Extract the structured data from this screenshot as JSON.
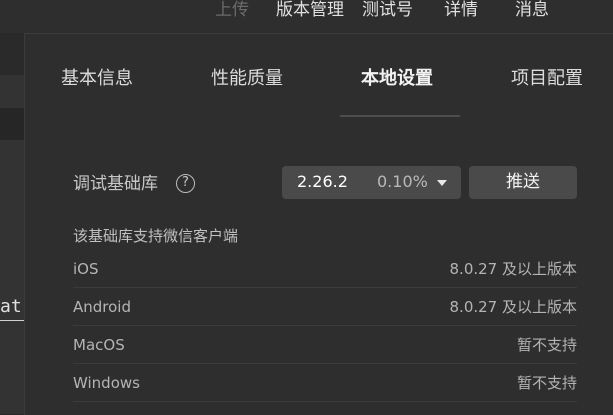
{
  "toolbar": {
    "upload": "上传",
    "version_manage": "版本管理",
    "test_account": "测试号",
    "details": "详情",
    "messages": "消息"
  },
  "editor": {
    "code_fragment": "at"
  },
  "panel": {
    "tabs": [
      {
        "label": "基本信息",
        "active": false
      },
      {
        "label": "性能质量",
        "active": false
      },
      {
        "label": "本地设置",
        "active": true
      },
      {
        "label": "项目配置",
        "active": false
      }
    ],
    "debug_lib": {
      "label": "调试基础库",
      "help_glyph": "?",
      "version": "2.26.2",
      "usage_percent": "0.10%",
      "push_label": "推送"
    },
    "support": {
      "title": "该基础库支持微信客户端",
      "rows": [
        {
          "os": "iOS",
          "requirement": "8.0.27 及以上版本"
        },
        {
          "os": "Android",
          "requirement": "8.0.27 及以上版本"
        },
        {
          "os": "MacOS",
          "requirement": "暂不支持"
        },
        {
          "os": "Windows",
          "requirement": "暂不支持"
        }
      ]
    }
  }
}
